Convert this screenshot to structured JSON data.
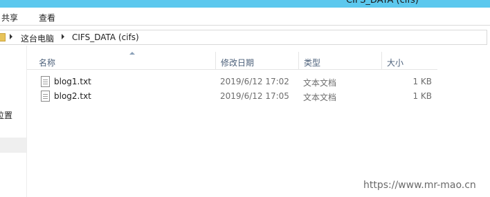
{
  "window": {
    "title": "CIFS_DATA (cifs)"
  },
  "ribbon": {
    "tabs": [
      {
        "label": "共享"
      },
      {
        "label": "查看"
      }
    ]
  },
  "address_bar": {
    "breadcrumbs": [
      "这台电脑",
      "CIFS_DATA (cifs)"
    ]
  },
  "nav_pane": {
    "partial_label": "位置"
  },
  "columns": [
    "名称",
    "修改日期",
    "类型",
    "大小"
  ],
  "files": [
    {
      "name": "blog1.txt",
      "modified": "2019/6/12 17:02",
      "type": "文本文档",
      "size": "1 KB"
    },
    {
      "name": "blog2.txt",
      "modified": "2019/6/12 17:05",
      "type": "文本文档",
      "size": "1 KB"
    }
  ],
  "watermark": "https://www.mr-mao.cn",
  "colors": {
    "titlebar": "#5cc8ee",
    "header_text": "#4c607a",
    "selection_gray": "#efefef"
  },
  "icons": {
    "address_folder": "folder-icon",
    "file": "text-file-icon",
    "breadcrumb_separator": "chevron-right-icon",
    "sort": "sort-ascending-icon"
  }
}
